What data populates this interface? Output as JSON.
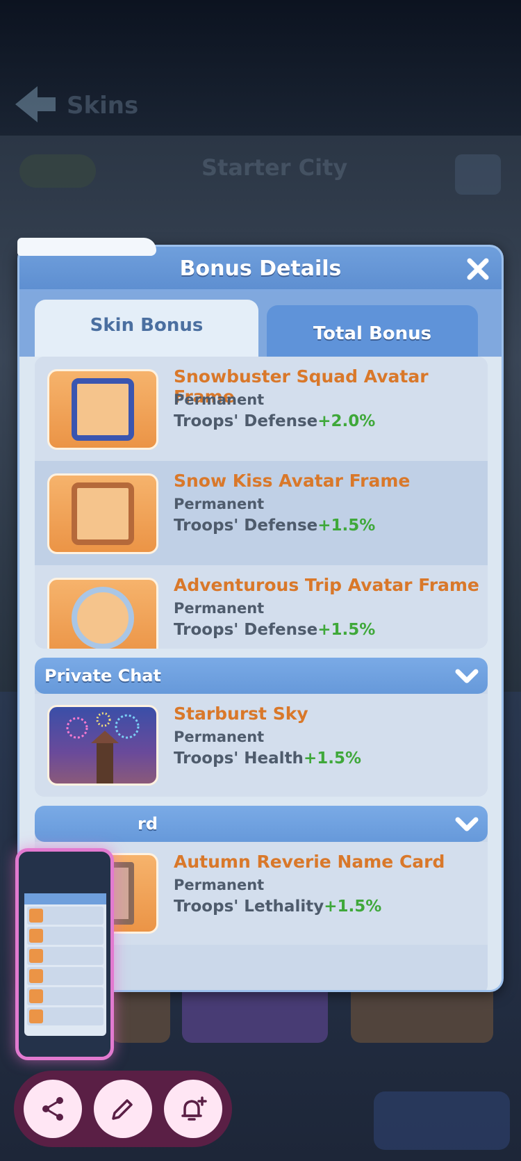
{
  "background": {
    "page_title": "Skins",
    "city_name": "Starter City"
  },
  "dialog": {
    "title": "Bonus Details",
    "tabs": [
      {
        "label": "Skin Bonus",
        "active": true
      },
      {
        "label": "Total Bonus",
        "active": false
      }
    ],
    "avatar_frames": [
      {
        "name": "Snowbuster Squad Avatar Frame",
        "duration": "Permanent",
        "stat": "Troops' Defense",
        "bonus": "+2.0%"
      },
      {
        "name": "Snow Kiss Avatar Frame",
        "duration": "Permanent",
        "stat": "Troops' Defense",
        "bonus": "+1.5%"
      },
      {
        "name": "Adventurous Trip Avatar Frame",
        "duration": "Permanent",
        "stat": "Troops' Defense",
        "bonus": "+1.5%"
      }
    ],
    "private_chat": {
      "title": "Private Chat",
      "items": [
        {
          "name": "Starburst Sky",
          "duration": "Permanent",
          "stat": "Troops' Health",
          "bonus": "+1.5%"
        }
      ]
    },
    "name_card": {
      "title": "rd",
      "items": [
        {
          "name": "Autumn Reverie Name Card",
          "duration": "Permanent",
          "stat": "Troops' Lethality",
          "bonus": "+1.5%"
        }
      ]
    }
  },
  "colors": {
    "item_name": "#d9782a",
    "bonus": "#3fa83a",
    "header_blue": "#6f9fdc",
    "action_bar": "#5a1f45"
  },
  "actions": [
    {
      "icon": "share-icon"
    },
    {
      "icon": "edit-icon"
    },
    {
      "icon": "add-reminder-icon"
    }
  ]
}
